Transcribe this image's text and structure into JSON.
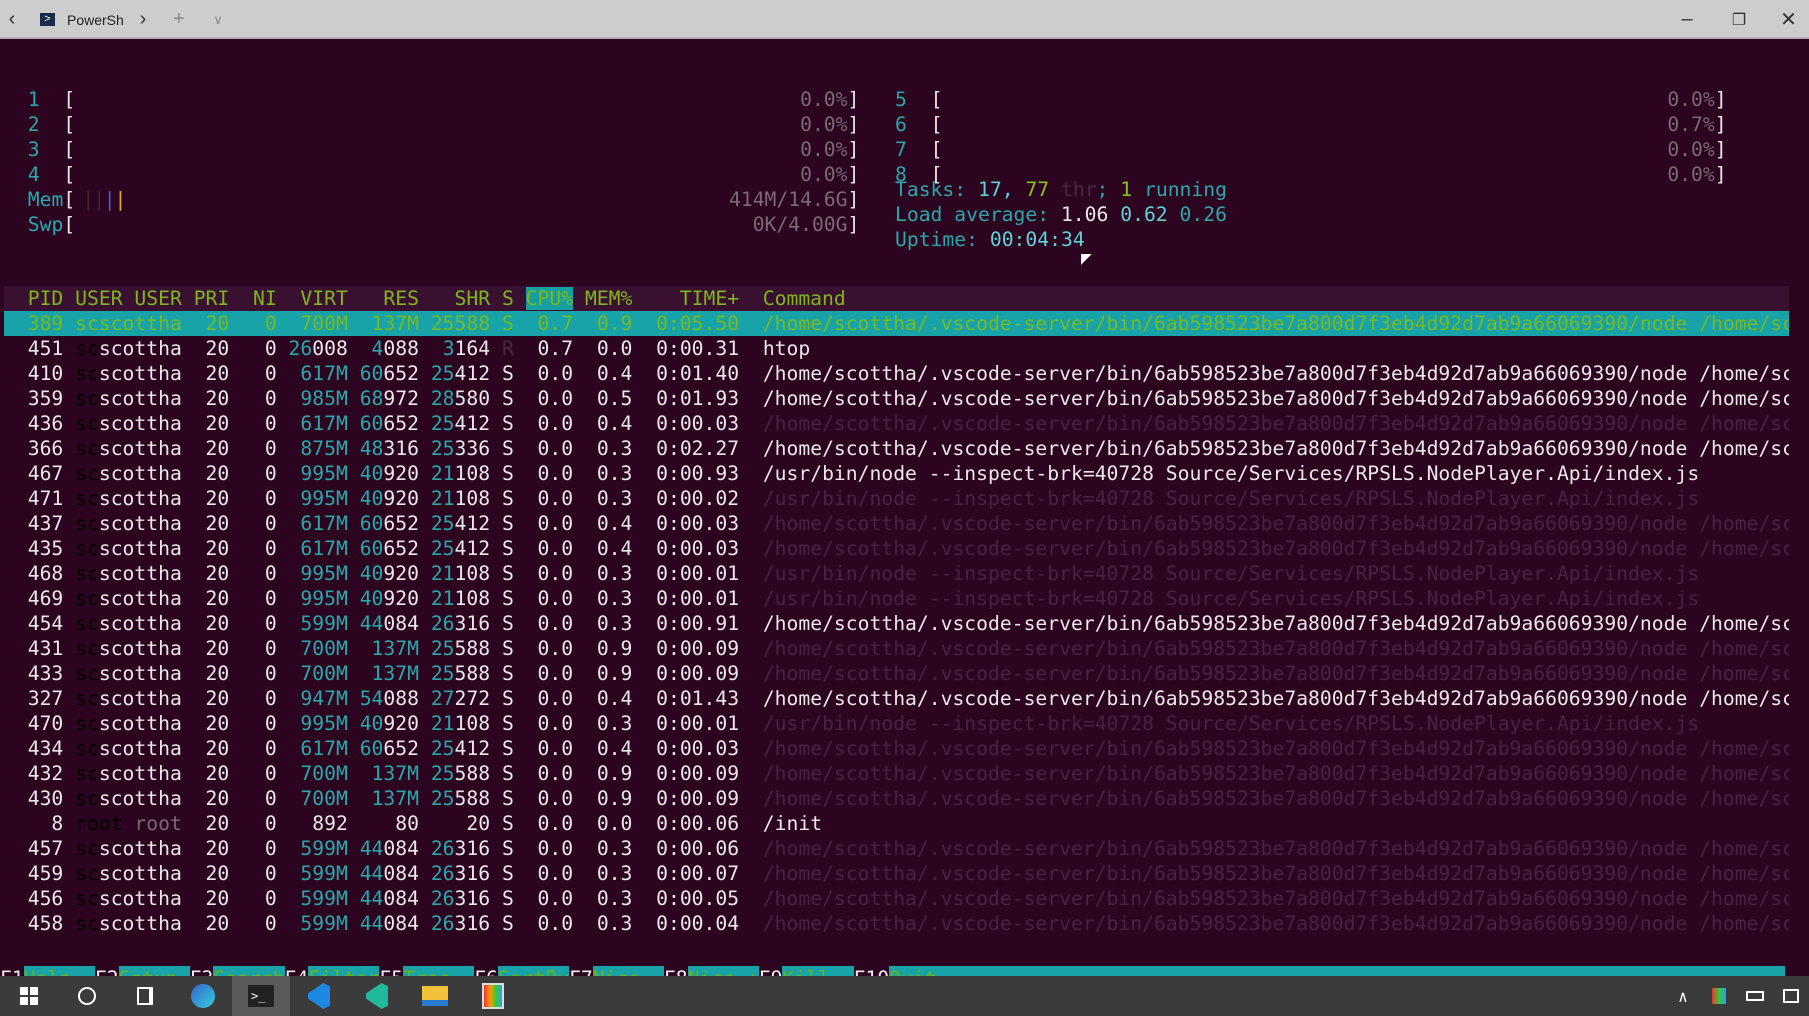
{
  "titlebar": {
    "tab_label": "PowerSh"
  },
  "meters": {
    "cpus": [
      {
        "n": "1",
        "v": "0.0%"
      },
      {
        "n": "2",
        "v": "0.0%"
      },
      {
        "n": "3",
        "v": "0.0%"
      },
      {
        "n": "4",
        "v": "0.0%"
      },
      {
        "n": "5",
        "v": "0.0%"
      },
      {
        "n": "6",
        "v": "0.7%"
      },
      {
        "n": "7",
        "v": "0.0%"
      },
      {
        "n": "8",
        "v": "0.0%"
      }
    ],
    "mem_label": "Mem",
    "mem_value": "414M/14.6G",
    "swp_label": "Swp",
    "swp_value": "0K/4.00G"
  },
  "stats": {
    "tasks_label": "Tasks:",
    "tasks_count": "17,",
    "threads": "77",
    "thr_label": "thr",
    "sep": ";",
    "running": "1",
    "running_label": "running",
    "load_label": "Load average:",
    "load1": "1.06",
    "load5": "0.62",
    "load15": "0.26",
    "uptime_label": "Uptime:",
    "uptime": "00:04:34"
  },
  "columns": {
    "pid": "PID",
    "user": "USER",
    "pri": "PRI",
    "ni": "NI",
    "virt": "VIRT",
    "res": "RES",
    "shr": "SHR",
    "s": "S",
    "cpu": "CPU%",
    "mem": "MEM%",
    "time": "TIME+",
    "cmd": "Command"
  },
  "cmds": {
    "vs": "/home/scottha/.vscode-server/bin/6ab598523be7a800d7f3eb4d92d7ab9a66069390/node /home/sc",
    "np": "/usr/bin/node --inspect-brk=40728 Source/Services/RPSLS.NodePlayer.Api/index.js"
  },
  "processes": [
    {
      "pid": "389",
      "user": "scottha",
      "pri": "20",
      "ni": "0",
      "virt": "700M",
      "res": "137M",
      "shr": "25588",
      "s": "S",
      "cpu": "0.7",
      "mem": "0.9",
      "time": "0:05.50",
      "cmd": "/home/scottha/.vscode-server/bin/6ab598523be7a800d7f3eb4d92d7ab9a66069390/node /home/sc",
      "selected": true
    },
    {
      "pid": "451",
      "user": "scottha",
      "pri": "20",
      "ni": "0",
      "virt": "26008",
      "res": "4088",
      "shr": "3164",
      "s": "R",
      "cpu": "0.7",
      "mem": "0.0",
      "time": "0:00.31",
      "cmd": "htop"
    },
    {
      "pid": "410",
      "user": "scottha",
      "pri": "20",
      "ni": "0",
      "virt": "617M",
      "res": "60652",
      "shr": "25412",
      "s": "S",
      "cpu": "0.0",
      "mem": "0.4",
      "time": "0:01.40",
      "cmd": "/home/scottha/.vscode-server/bin/6ab598523be7a800d7f3eb4d92d7ab9a66069390/node /home/sc"
    },
    {
      "pid": "359",
      "user": "scottha",
      "pri": "20",
      "ni": "0",
      "virt": "985M",
      "res": "68972",
      "shr": "28580",
      "s": "S",
      "cpu": "0.0",
      "mem": "0.5",
      "time": "0:01.93",
      "cmd": "/home/scottha/.vscode-server/bin/6ab598523be7a800d7f3eb4d92d7ab9a66069390/node /home/sc"
    },
    {
      "pid": "436",
      "user": "scottha",
      "pri": "20",
      "ni": "0",
      "virt": "617M",
      "res": "60652",
      "shr": "25412",
      "s": "S",
      "cpu": "0.0",
      "mem": "0.4",
      "time": "0:00.03",
      "cmd": "/home/scottha/.vscode-server/bin/6ab598523be7a800d7f3eb4d92d7ab9a66069390/node /home/sc",
      "thread": true
    },
    {
      "pid": "366",
      "user": "scottha",
      "pri": "20",
      "ni": "0",
      "virt": "875M",
      "res": "48316",
      "shr": "25336",
      "s": "S",
      "cpu": "0.0",
      "mem": "0.3",
      "time": "0:02.27",
      "cmd": "/home/scottha/.vscode-server/bin/6ab598523be7a800d7f3eb4d92d7ab9a66069390/node /home/sc"
    },
    {
      "pid": "467",
      "user": "scottha",
      "pri": "20",
      "ni": "0",
      "virt": "995M",
      "res": "40920",
      "shr": "21108",
      "s": "S",
      "cpu": "0.0",
      "mem": "0.3",
      "time": "0:00.93",
      "cmd": "/usr/bin/node --inspect-brk=40728 Source/Services/RPSLS.NodePlayer.Api/index.js"
    },
    {
      "pid": "471",
      "user": "scottha",
      "pri": "20",
      "ni": "0",
      "virt": "995M",
      "res": "40920",
      "shr": "21108",
      "s": "S",
      "cpu": "0.0",
      "mem": "0.3",
      "time": "0:00.02",
      "cmd": "/usr/bin/node --inspect-brk=40728 Source/Services/RPSLS.NodePlayer.Api/index.js",
      "thread": true
    },
    {
      "pid": "437",
      "user": "scottha",
      "pri": "20",
      "ni": "0",
      "virt": "617M",
      "res": "60652",
      "shr": "25412",
      "s": "S",
      "cpu": "0.0",
      "mem": "0.4",
      "time": "0:00.03",
      "cmd": "/home/scottha/.vscode-server/bin/6ab598523be7a800d7f3eb4d92d7ab9a66069390/node /home/sc",
      "thread": true
    },
    {
      "pid": "435",
      "user": "scottha",
      "pri": "20",
      "ni": "0",
      "virt": "617M",
      "res": "60652",
      "shr": "25412",
      "s": "S",
      "cpu": "0.0",
      "mem": "0.4",
      "time": "0:00.03",
      "cmd": "/home/scottha/.vscode-server/bin/6ab598523be7a800d7f3eb4d92d7ab9a66069390/node /home/sc",
      "thread": true
    },
    {
      "pid": "468",
      "user": "scottha",
      "pri": "20",
      "ni": "0",
      "virt": "995M",
      "res": "40920",
      "shr": "21108",
      "s": "S",
      "cpu": "0.0",
      "mem": "0.3",
      "time": "0:00.01",
      "cmd": "/usr/bin/node --inspect-brk=40728 Source/Services/RPSLS.NodePlayer.Api/index.js",
      "thread": true
    },
    {
      "pid": "469",
      "user": "scottha",
      "pri": "20",
      "ni": "0",
      "virt": "995M",
      "res": "40920",
      "shr": "21108",
      "s": "S",
      "cpu": "0.0",
      "mem": "0.3",
      "time": "0:00.01",
      "cmd": "/usr/bin/node --inspect-brk=40728 Source/Services/RPSLS.NodePlayer.Api/index.js",
      "thread": true
    },
    {
      "pid": "454",
      "user": "scottha",
      "pri": "20",
      "ni": "0",
      "virt": "599M",
      "res": "44084",
      "shr": "26316",
      "s": "S",
      "cpu": "0.0",
      "mem": "0.3",
      "time": "0:00.91",
      "cmd": "/home/scottha/.vscode-server/bin/6ab598523be7a800d7f3eb4d92d7ab9a66069390/node /home/sc"
    },
    {
      "pid": "431",
      "user": "scottha",
      "pri": "20",
      "ni": "0",
      "virt": "700M",
      "res": "137M",
      "shr": "25588",
      "s": "S",
      "cpu": "0.0",
      "mem": "0.9",
      "time": "0:00.09",
      "cmd": "/home/scottha/.vscode-server/bin/6ab598523be7a800d7f3eb4d92d7ab9a66069390/node /home/sc",
      "thread": true
    },
    {
      "pid": "433",
      "user": "scottha",
      "pri": "20",
      "ni": "0",
      "virt": "700M",
      "res": "137M",
      "shr": "25588",
      "s": "S",
      "cpu": "0.0",
      "mem": "0.9",
      "time": "0:00.09",
      "cmd": "/home/scottha/.vscode-server/bin/6ab598523be7a800d7f3eb4d92d7ab9a66069390/node /home/sc",
      "thread": true
    },
    {
      "pid": "327",
      "user": "scottha",
      "pri": "20",
      "ni": "0",
      "virt": "947M",
      "res": "54088",
      "shr": "27272",
      "s": "S",
      "cpu": "0.0",
      "mem": "0.4",
      "time": "0:01.43",
      "cmd": "/home/scottha/.vscode-server/bin/6ab598523be7a800d7f3eb4d92d7ab9a66069390/node /home/sc"
    },
    {
      "pid": "470",
      "user": "scottha",
      "pri": "20",
      "ni": "0",
      "virt": "995M",
      "res": "40920",
      "shr": "21108",
      "s": "S",
      "cpu": "0.0",
      "mem": "0.3",
      "time": "0:00.01",
      "cmd": "/usr/bin/node --inspect-brk=40728 Source/Services/RPSLS.NodePlayer.Api/index.js",
      "thread": true
    },
    {
      "pid": "434",
      "user": "scottha",
      "pri": "20",
      "ni": "0",
      "virt": "617M",
      "res": "60652",
      "shr": "25412",
      "s": "S",
      "cpu": "0.0",
      "mem": "0.4",
      "time": "0:00.03",
      "cmd": "/home/scottha/.vscode-server/bin/6ab598523be7a800d7f3eb4d92d7ab9a66069390/node /home/sc",
      "thread": true
    },
    {
      "pid": "432",
      "user": "scottha",
      "pri": "20",
      "ni": "0",
      "virt": "700M",
      "res": "137M",
      "shr": "25588",
      "s": "S",
      "cpu": "0.0",
      "mem": "0.9",
      "time": "0:00.09",
      "cmd": "/home/scottha/.vscode-server/bin/6ab598523be7a800d7f3eb4d92d7ab9a66069390/node /home/sc",
      "thread": true
    },
    {
      "pid": "430",
      "user": "scottha",
      "pri": "20",
      "ni": "0",
      "virt": "700M",
      "res": "137M",
      "shr": "25588",
      "s": "S",
      "cpu": "0.0",
      "mem": "0.9",
      "time": "0:00.09",
      "cmd": "/home/scottha/.vscode-server/bin/6ab598523be7a800d7f3eb4d92d7ab9a66069390/node /home/sc",
      "thread": true
    },
    {
      "pid": "8",
      "user": "root",
      "pri": "20",
      "ni": "0",
      "virt": "892",
      "res": "80",
      "shr": "20",
      "s": "S",
      "cpu": "0.0",
      "mem": "0.0",
      "time": "0:00.06",
      "cmd": "/init"
    },
    {
      "pid": "457",
      "user": "scottha",
      "pri": "20",
      "ni": "0",
      "virt": "599M",
      "res": "44084",
      "shr": "26316",
      "s": "S",
      "cpu": "0.0",
      "mem": "0.3",
      "time": "0:00.06",
      "cmd": "/home/scottha/.vscode-server/bin/6ab598523be7a800d7f3eb4d92d7ab9a66069390/node /home/sc",
      "thread": true
    },
    {
      "pid": "459",
      "user": "scottha",
      "pri": "20",
      "ni": "0",
      "virt": "599M",
      "res": "44084",
      "shr": "26316",
      "s": "S",
      "cpu": "0.0",
      "mem": "0.3",
      "time": "0:00.07",
      "cmd": "/home/scottha/.vscode-server/bin/6ab598523be7a800d7f3eb4d92d7ab9a66069390/node /home/sc",
      "thread": true
    },
    {
      "pid": "456",
      "user": "scottha",
      "pri": "20",
      "ni": "0",
      "virt": "599M",
      "res": "44084",
      "shr": "26316",
      "s": "S",
      "cpu": "0.0",
      "mem": "0.3",
      "time": "0:00.05",
      "cmd": "/home/scottha/.vscode-server/bin/6ab598523be7a800d7f3eb4d92d7ab9a66069390/node /home/sc",
      "thread": true
    },
    {
      "pid": "458",
      "user": "scottha",
      "pri": "20",
      "ni": "0",
      "virt": "599M",
      "res": "44084",
      "shr": "26316",
      "s": "S",
      "cpu": "0.0",
      "mem": "0.3",
      "time": "0:00.04",
      "cmd": "/home/scottha/.vscode-server/bin/6ab598523be7a800d7f3eb4d92d7ab9a66069390/node /home/sc",
      "thread": true
    }
  ],
  "fkeys": [
    {
      "key": "F1",
      "label": "Help  "
    },
    {
      "key": "F2",
      "label": "Setup "
    },
    {
      "key": "F3",
      "label": "Search"
    },
    {
      "key": "F4",
      "label": "Filter"
    },
    {
      "key": "F5",
      "label": "Tree  "
    },
    {
      "key": "F6",
      "label": "SortBy"
    },
    {
      "key": "F7",
      "label": "Nice -"
    },
    {
      "key": "F8",
      "label": "Nice +"
    },
    {
      "key": "F9",
      "label": "Kill  "
    },
    {
      "key": "F10",
      "label": "Quit"
    }
  ],
  "colors": {
    "background": "#2c0420",
    "accent": "#17a3a8",
    "header_text": "#7fb51a"
  }
}
